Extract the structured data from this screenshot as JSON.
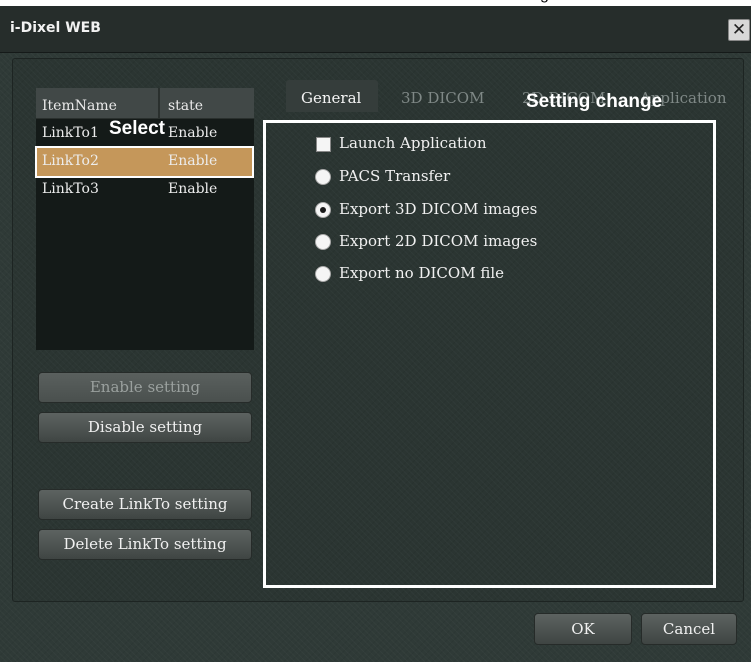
{
  "window": {
    "title": "i-Dixel WEB",
    "close_label": "✕"
  },
  "clipped_caption": "g",
  "list": {
    "headers": {
      "name": "ItemName",
      "state": "state"
    },
    "rows": [
      {
        "name": "LinkTo1",
        "state": "Enable"
      },
      {
        "name": "LinkTo2",
        "state": "Enable"
      },
      {
        "name": "LinkTo3",
        "state": "Enable"
      }
    ]
  },
  "annotations": {
    "select": "Select",
    "setting_change": "Setting change"
  },
  "buttons": {
    "enable": "Enable setting",
    "disable": "Disable setting",
    "create": "Create LinkTo setting",
    "delete": "Delete LinkTo setting"
  },
  "tabs": [
    {
      "label": "General"
    },
    {
      "label": "3D DICOM"
    },
    {
      "label": "2D DICOM"
    },
    {
      "label": "Application"
    }
  ],
  "options": [
    {
      "label": "Launch Application"
    },
    {
      "label": "PACS Transfer"
    },
    {
      "label": "Export 3D DICOM images"
    },
    {
      "label": "Export 2D DICOM images"
    },
    {
      "label": "Export no DICOM file"
    }
  ],
  "footer": {
    "ok": "OK",
    "cancel": "Cancel"
  },
  "colors": {
    "selected_row": "#c5975a",
    "annotation": "#ffffff"
  }
}
